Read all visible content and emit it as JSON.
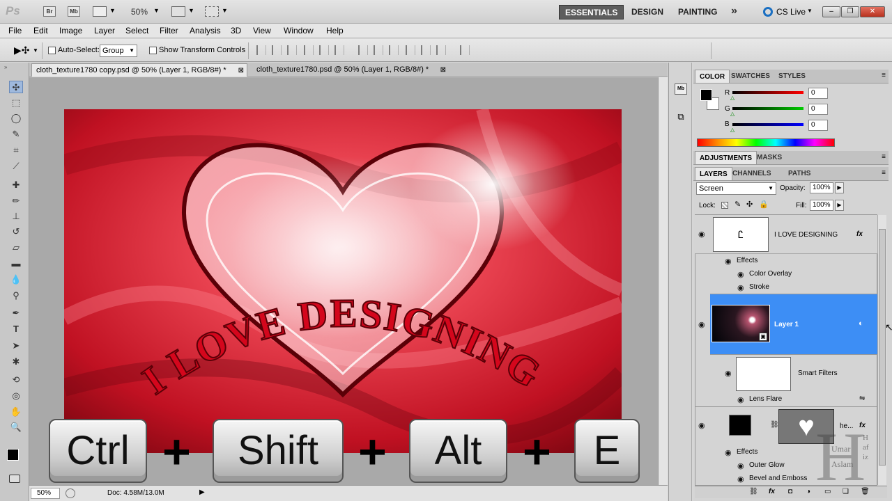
{
  "appbar": {
    "logo": "Ps",
    "bridge": "Br",
    "minibridge": "Mb",
    "zoom": "50%",
    "workspaces": [
      "ESSENTIALS",
      "DESIGN",
      "PAINTING"
    ],
    "more": "»",
    "cslive": "CS Live"
  },
  "menu": [
    "File",
    "Edit",
    "Image",
    "Layer",
    "Select",
    "Filter",
    "Analysis",
    "3D",
    "View",
    "Window",
    "Help"
  ],
  "options": {
    "autoselect_label": "Auto-Select:",
    "autoselect_value": "Group",
    "transform_label": "Show Transform Controls"
  },
  "tabs": [
    {
      "label": "cloth_texture1780 copy.psd @ 50% (Layer 1, RGB/8#) *"
    },
    {
      "label": "cloth_texture1780.psd @ 50% (Layer 1, RGB/8#) *"
    }
  ],
  "canvas": {
    "curve_text": "I LOVE DESIGNING",
    "keys": [
      "Ctrl",
      "Shift",
      "Alt",
      "E"
    ],
    "plus": "+"
  },
  "status": {
    "zoom": "50%",
    "doc": "Doc: 4.58M/13.0M"
  },
  "color_panel": {
    "tabs": [
      "COLOR",
      "SWATCHES",
      "STYLES"
    ],
    "r_label": "R",
    "g_label": "G",
    "b_label": "B",
    "r": "0",
    "g": "0",
    "b": "0"
  },
  "adjust_tabs": [
    "ADJUSTMENTS",
    "MASKS"
  ],
  "layers_panel": {
    "tabs": [
      "LAYERS",
      "CHANNELS",
      "PATHS"
    ],
    "blend_mode": "Screen",
    "opacity_label": "Opacity:",
    "opacity": "100%",
    "lock_label": "Lock:",
    "fill_label": "Fill:",
    "fill": "100%",
    "layers": [
      {
        "name": "I LOVE DESIGNING",
        "fx": "fx",
        "effects_label": "Effects",
        "effects": [
          "Color Overlay",
          "Stroke"
        ]
      },
      {
        "name": "Layer 1",
        "smart_filters": "Smart Filters",
        "filter": "Lens Flare"
      },
      {
        "name": "he...",
        "fx": "fx",
        "effects_label": "Effects",
        "effects": [
          "Outer Glow",
          "Bevel and Emboss"
        ]
      }
    ]
  },
  "watermark": {
    "letter": "H",
    "line1": "Umar",
    "line2": "Aslam",
    "side": "Hafiz"
  },
  "colors": {
    "accent": "#3399ff",
    "selected_row": "#3d8ef5"
  }
}
